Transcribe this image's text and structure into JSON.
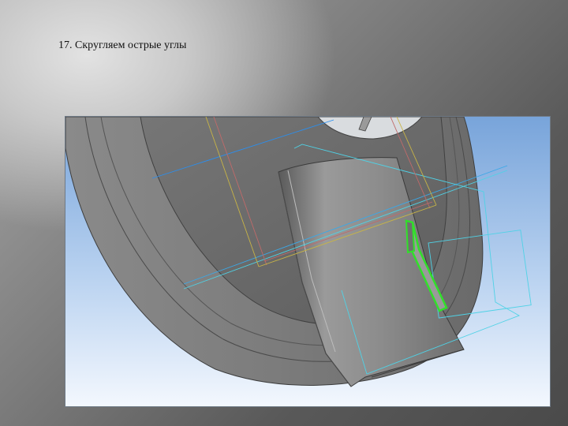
{
  "slide": {
    "title": "17. Скругляем острые углы"
  },
  "cad_view": {
    "icons": [
      "model-part",
      "selected-edge-highlight"
    ],
    "colors": {
      "background_top": "#7aa7dc",
      "background_bottom": "#f4f8fe",
      "model_body": "#8a8a8a",
      "model_dark": "#5a5a5a",
      "axis_blue": "#2a8ff0",
      "axis_cyan": "#4fd2e6",
      "sketch_yellow": "#c8b446",
      "sketch_red": "#c06a6a",
      "selection_green": "#31e02a"
    }
  }
}
